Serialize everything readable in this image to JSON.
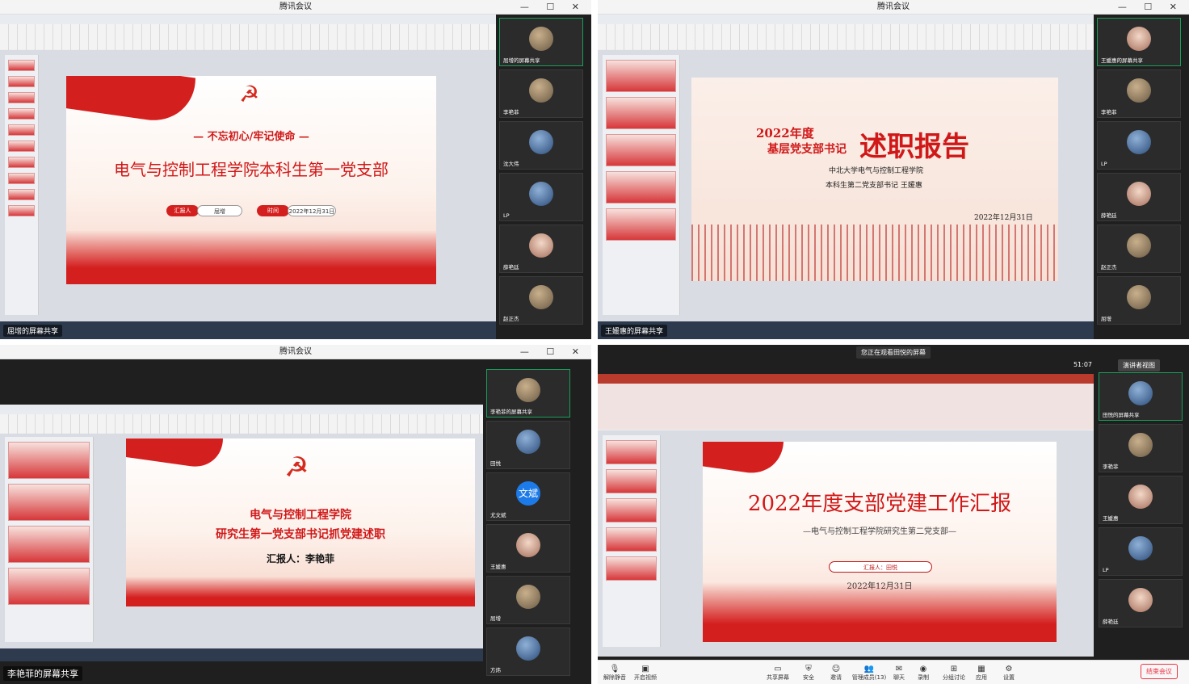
{
  "q1": {
    "window_title": "腾讯会议",
    "slide": {
      "subtitle": "— 不忘初心/牢记使命 —",
      "title": "电气与控制工程学院本科生第一党支部",
      "reporter_label": "汇报人",
      "reporter": "屈增",
      "time_label": "时间",
      "date": "2022年12月31日"
    },
    "share_label": "屈增的屏幕共享",
    "participants": [
      {
        "name": "屈增的屏幕共享",
        "avatar": "default"
      },
      {
        "name": "李艳菲",
        "avatar": "default"
      },
      {
        "name": "沈大伟",
        "avatar": "blue"
      },
      {
        "name": "LP",
        "avatar": "blue"
      },
      {
        "name": "薛艳廷",
        "avatar": "girl"
      },
      {
        "name": "赵正杰",
        "avatar": "default"
      }
    ]
  },
  "q2": {
    "window_title": "腾讯会议",
    "slide": {
      "year": "2022年度",
      "role": "基层党支部书记",
      "big_title": "述职报告",
      "org": "中北大学电气与控制工程学院",
      "branch": "本科生第二党支部书记 王媛惠",
      "date": "2022年12月31日"
    },
    "share_label": "王媛惠的屏幕共享",
    "participants": [
      {
        "name": "王媛惠的屏幕共享",
        "avatar": "girl"
      },
      {
        "name": "李艳菲",
        "avatar": "default"
      },
      {
        "name": "LP",
        "avatar": "blue"
      },
      {
        "name": "薛艳廷",
        "avatar": "girl"
      },
      {
        "name": "赵正杰",
        "avatar": "default"
      },
      {
        "name": "屈增",
        "avatar": "default"
      }
    ]
  },
  "q3": {
    "window_title": "腾讯会议",
    "slide": {
      "line1": "电气与控制工程学院",
      "line2": "研究生第一党支部书记抓党建述职",
      "reporter": "汇报人：李艳菲"
    },
    "share_label": "李艳菲的屏幕共享",
    "participants": [
      {
        "name": "李艳菲的屏幕共享",
        "avatar": "default"
      },
      {
        "name": "田悦",
        "avatar": "blue"
      },
      {
        "name": "尤文斌",
        "avatar": "text",
        "avatar_text": "文斌"
      },
      {
        "name": "王媛惠",
        "avatar": "girl"
      },
      {
        "name": "屈增",
        "avatar": "default"
      },
      {
        "name": "方炜",
        "avatar": "blue"
      }
    ]
  },
  "q4": {
    "toast": "您正在观看田悦的屏幕",
    "timer": "51:07",
    "view_mode": "演讲者视图",
    "slide": {
      "title": "2022年度支部党建工作汇报",
      "subtitle": "—电气与控制工程学院研究生第二党支部—",
      "reporter": "汇报人：田悦",
      "date": "2022年12月31日"
    },
    "participants": [
      {
        "name": "田悦的屏幕共享",
        "avatar": "blue"
      },
      {
        "name": "李艳菲",
        "avatar": "default"
      },
      {
        "name": "王媛惠",
        "avatar": "girl"
      },
      {
        "name": "LP",
        "avatar": "blue"
      },
      {
        "name": "薛艳廷",
        "avatar": "girl"
      }
    ],
    "toolbar": [
      {
        "label": "解除静音",
        "icon": "mic-off-icon"
      },
      {
        "label": "开启视频",
        "icon": "camera-off-icon"
      },
      {
        "label": "共享屏幕",
        "icon": "screen-share-icon"
      },
      {
        "label": "安全",
        "icon": "shield-icon"
      },
      {
        "label": "邀请",
        "icon": "invite-icon"
      },
      {
        "label": "管理成员(13)",
        "icon": "members-icon"
      },
      {
        "label": "聊天",
        "icon": "chat-icon"
      },
      {
        "label": "录制",
        "icon": "record-icon"
      },
      {
        "label": "分组讨论",
        "icon": "breakout-icon"
      },
      {
        "label": "应用",
        "icon": "apps-icon"
      },
      {
        "label": "设置",
        "icon": "gear-icon"
      }
    ],
    "end_label": "结束会议"
  }
}
